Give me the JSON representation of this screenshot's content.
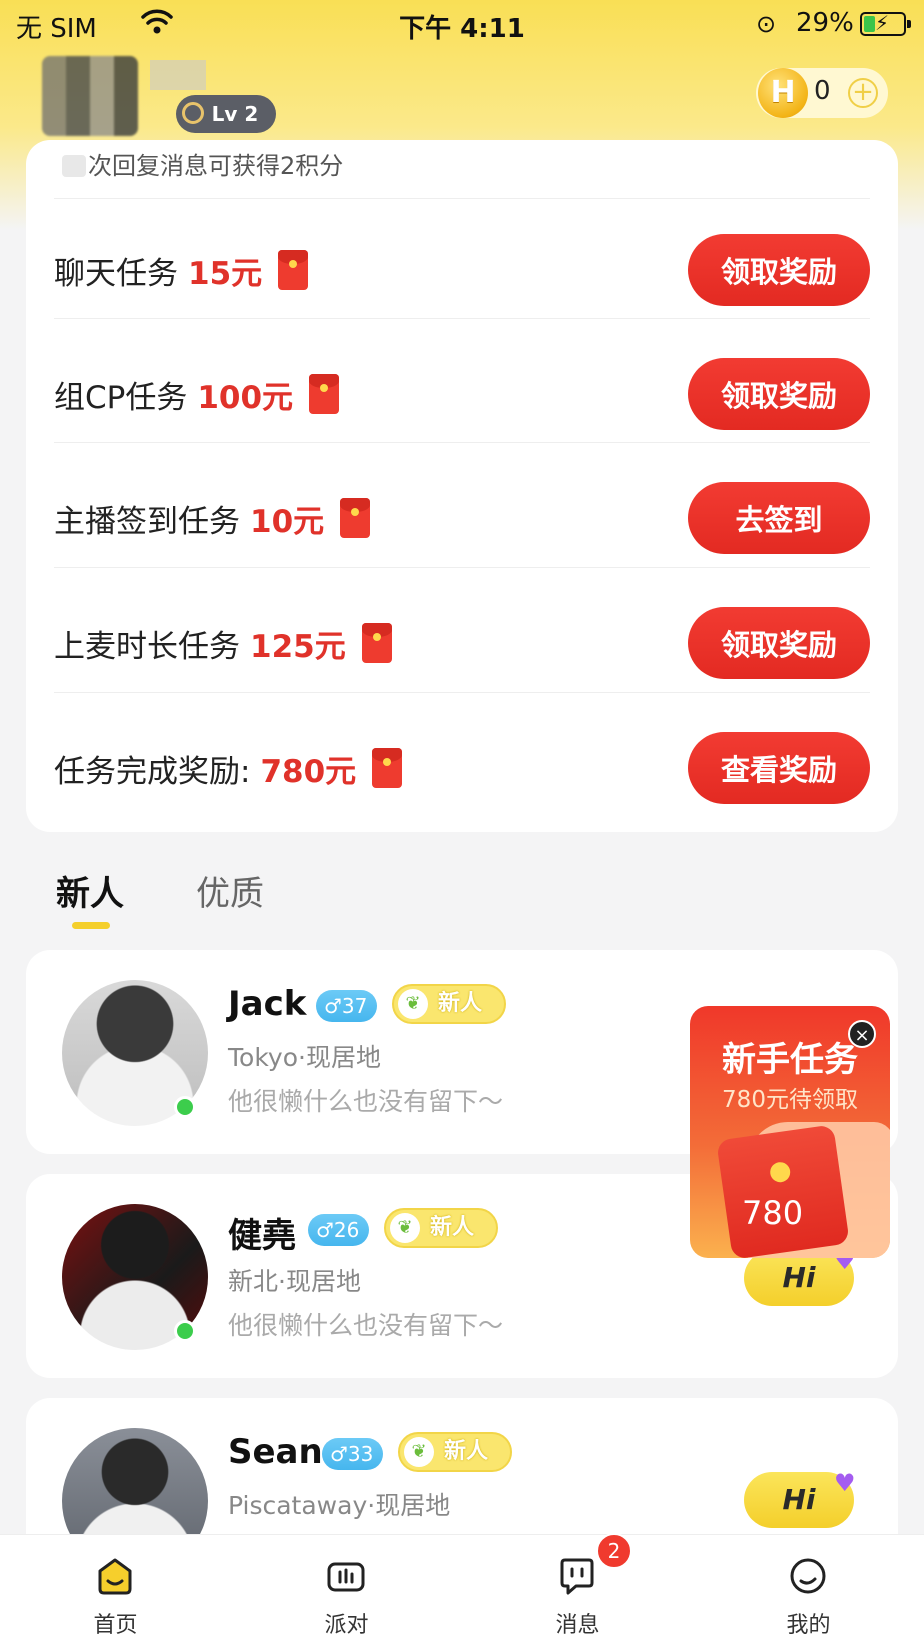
{
  "status_bar": {
    "carrier": "无 SIM",
    "time": "下午 4:11",
    "battery": "29%",
    "battery_level": 0.29
  },
  "header": {
    "level": "Lv 2",
    "coins": "0",
    "coin_symbol": "H",
    "add_symbol": "+"
  },
  "tasks": {
    "tip": "次回复消息可获得2积分",
    "rows": [
      {
        "label": "聊天任务",
        "amount": "15元",
        "button": "领取奖励"
      },
      {
        "label": "组CP任务",
        "amount": "100元",
        "button": "领取奖励"
      },
      {
        "label": "主播签到任务",
        "amount": "10元",
        "button": "去签到"
      },
      {
        "label": "上麦时长任务",
        "amount": "125元",
        "button": "领取奖励"
      },
      {
        "label": "任务完成奖励:",
        "amount": "780元",
        "button": "查看奖励"
      }
    ]
  },
  "tabs": {
    "new": "新人",
    "quality": "优质"
  },
  "users": [
    {
      "name": "Jack",
      "age": "♂37",
      "badge": "新人",
      "location": "Tokyo·现居地",
      "bio": "他很懒什么也没有留下～"
    },
    {
      "name": "健堯",
      "age": "♂26",
      "badge": "新人",
      "location": "新北·现居地",
      "bio": "他很懒什么也没有留下～"
    },
    {
      "name": "Sean",
      "age": "♂33",
      "badge": "新人",
      "location": "Piscataway·现居地",
      "bio": ""
    }
  ],
  "hi_label": "Hi",
  "float_task": {
    "title": "新手任务",
    "subtitle": "780元待领取",
    "amount": "780",
    "close": "×"
  },
  "nav": {
    "items": [
      {
        "label": "首页",
        "icon": "home-face-icon"
      },
      {
        "label": "派对",
        "icon": "party-tv-icon"
      },
      {
        "label": "消息",
        "icon": "chat-bubble-icon",
        "badge": "2"
      },
      {
        "label": "我的",
        "icon": "profile-circle-icon"
      }
    ]
  },
  "colors": {
    "accent_yellow": "#f4cf2b",
    "reward_red": "#e32a22",
    "online_green": "#3ccd4c",
    "age_blue": "#46b6ee"
  }
}
